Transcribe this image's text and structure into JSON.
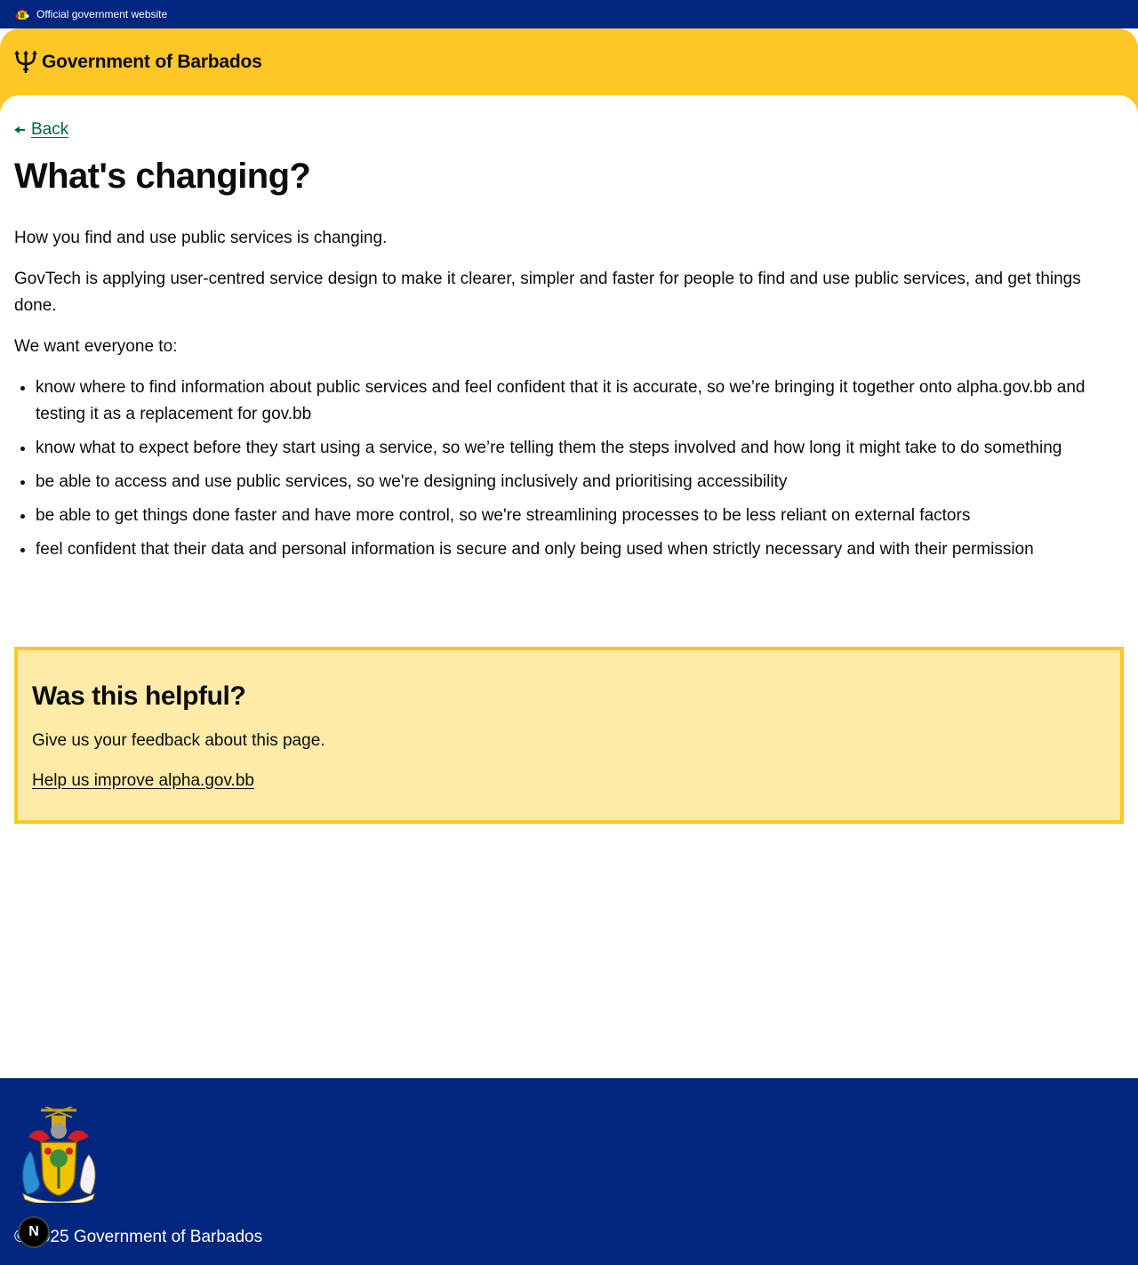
{
  "topbar": {
    "official_label": "Official government website"
  },
  "header": {
    "brand": "Government of Barbados"
  },
  "nav": {
    "back_label": "Back"
  },
  "page": {
    "title": "What's changing?",
    "paragraphs": [
      "How you find and use public services is changing.",
      "GovTech is applying user-centred service design to make it clearer, simpler and faster for people to find and use public services, and get things done.",
      "We want everyone to:"
    ],
    "bullets": [
      "know where to find information about public services and feel confident that it is accurate, so we’re bringing it together onto alpha.gov.bb and testing it as a replacement for gov.bb",
      "know what to expect before they start using a service, so we’re telling them the steps involved and how long it might take to do something",
      "be able to access and use public services, so we're designing inclusively and prioritising accessibility",
      "be able to get things done faster and have more control, so we're streamlining processes to be less reliant on external factors",
      "feel confident that their data and personal information is secure and only being used when strictly necessary and with their permission"
    ]
  },
  "feedback": {
    "heading": "Was this helpful?",
    "text": "Give us your feedback about this page.",
    "link_label": "Help us improve alpha.gov.bb"
  },
  "footer": {
    "copyright": "© 2025 Government of Barbados"
  },
  "dev_badge": {
    "label": "N"
  },
  "icons": {
    "crest_small": "coat-of-arms-icon",
    "trident": "trident-icon",
    "back_arrow": "arrow-left-icon",
    "footer_crest": "coat-of-arms-icon"
  },
  "colors": {
    "navy": "#00267f",
    "gold": "#ffc726",
    "feedback_bg": "#ffeba8",
    "link_green": "#00654a"
  }
}
